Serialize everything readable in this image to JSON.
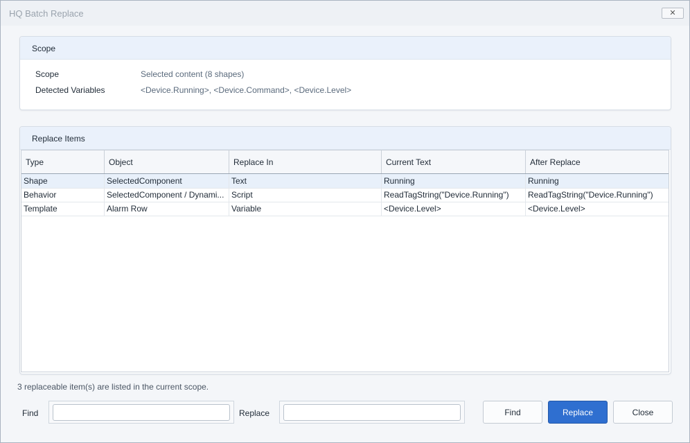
{
  "window": {
    "title": "HQ Batch Replace",
    "close_glyph": "✕"
  },
  "scope_panel": {
    "title": "Scope",
    "rows": [
      {
        "label": "Scope",
        "value": "Selected content (8 shapes)"
      },
      {
        "label": "Detected Variables",
        "value": "<Device.Running>, <Device.Command>, <Device.Level>"
      }
    ]
  },
  "replace_panel": {
    "title": "Replace Items",
    "columns": [
      "Type",
      "Object",
      "Replace In",
      "Current Text",
      "After Replace"
    ],
    "rows": [
      [
        "Shape",
        "SelectedComponent",
        "Text",
        "Running",
        "Running"
      ],
      [
        "Behavior",
        "SelectedComponent / Dynami...",
        "Script",
        "ReadTagString(\"Device.Running\")",
        "ReadTagString(\"Device.Running\")"
      ],
      [
        "Template",
        "Alarm Row",
        "Variable",
        "<Device.Level>",
        "<Device.Level>"
      ]
    ]
  },
  "status_text": "3 replaceable item(s) are listed in the current scope.",
  "find": {
    "label": "Find",
    "value": "",
    "placeholder": ""
  },
  "replace": {
    "label": "Replace",
    "value": "",
    "placeholder": ""
  },
  "buttons": {
    "find": "Find",
    "replace": "Replace",
    "close": "Close"
  },
  "colors": {
    "accent": "#2f6fd0",
    "header_bg": "#eaf1fb",
    "selected_row": "#e8f0fa"
  }
}
